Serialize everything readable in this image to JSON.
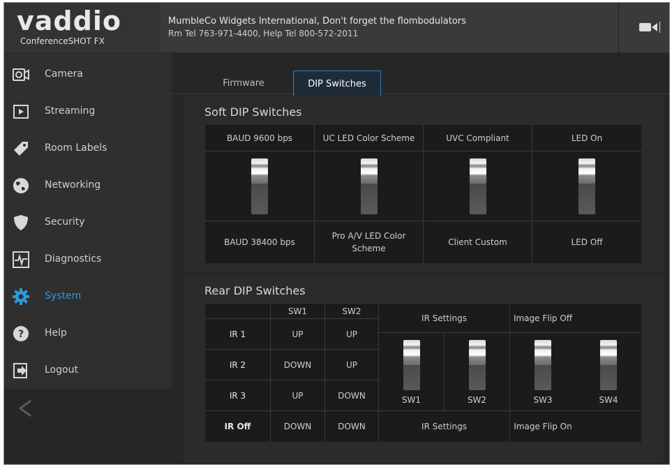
{
  "brand": {
    "logo": "vaddio",
    "product": "ConferenceSHOT FX"
  },
  "header": {
    "title": "MumbleCo Widgets International, Don't forget the flombodulators",
    "subtitle": "Rm Tel 763-971-4400, Help Tel 800-572-2011",
    "icon": "video-camera-icon"
  },
  "sidebar": {
    "items": [
      {
        "label": "Camera",
        "icon": "camera-icon"
      },
      {
        "label": "Streaming",
        "icon": "play-icon"
      },
      {
        "label": "Room Labels",
        "icon": "tag-icon"
      },
      {
        "label": "Networking",
        "icon": "globe-icon"
      },
      {
        "label": "Security",
        "icon": "shield-icon"
      },
      {
        "label": "Diagnostics",
        "icon": "pulse-icon"
      },
      {
        "label": "System",
        "icon": "gear-icon",
        "active": true
      },
      {
        "label": "Help",
        "icon": "question-icon"
      },
      {
        "label": "Logout",
        "icon": "logout-icon"
      }
    ],
    "collapse_icon": "chevron-left-icon",
    "accent": "#2c9be0"
  },
  "tabs": [
    {
      "label": "Firmware"
    },
    {
      "label": "DIP Switches",
      "active": true
    }
  ],
  "soft": {
    "title": "Soft DIP Switches",
    "top_labels": [
      "BAUD 9600 bps",
      "UC LED Color Scheme",
      "UVC Compliant",
      "LED On"
    ],
    "bottom_labels": [
      "BAUD 38400 bps",
      "Pro A/V LED Color Scheme",
      "Client Custom",
      "LED Off"
    ]
  },
  "rear": {
    "title": "Rear DIP Switches",
    "ir_table": {
      "headers": [
        "",
        "SW1",
        "SW2"
      ],
      "rows": [
        [
          "IR 1",
          "UP",
          "UP"
        ],
        [
          "IR 2",
          "DOWN",
          "UP"
        ],
        [
          "IR 3",
          "UP",
          "DOWN"
        ],
        [
          "IR Off",
          "DOWN",
          "DOWN"
        ]
      ]
    },
    "top_labels": [
      "IR Settings",
      "Image Flip Off"
    ],
    "switch_labels": [
      "SW1",
      "SW2",
      "SW3",
      "SW4"
    ],
    "bottom_labels": [
      "IR Settings",
      "Image Flip On"
    ]
  }
}
